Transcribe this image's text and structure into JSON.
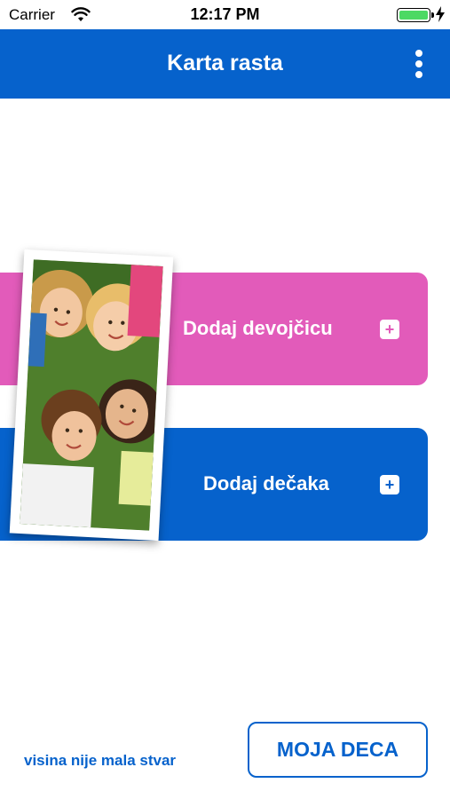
{
  "status_bar": {
    "carrier": "Carrier",
    "time": "12:17 PM",
    "battery_level": 1.0
  },
  "header": {
    "title": "Karta rasta",
    "menu_icon": "more-vertical-icon"
  },
  "buttons": {
    "add_girl": "Dodaj devojčicu",
    "add_boy": "Dodaj dečaka",
    "plus_symbol": "+"
  },
  "footer": {
    "slogan": "visina nije mala stvar",
    "my_kids_button": "MOJA DECA"
  },
  "colors": {
    "brand_blue": "#0662cc",
    "girl_pink": "#e25bba"
  }
}
